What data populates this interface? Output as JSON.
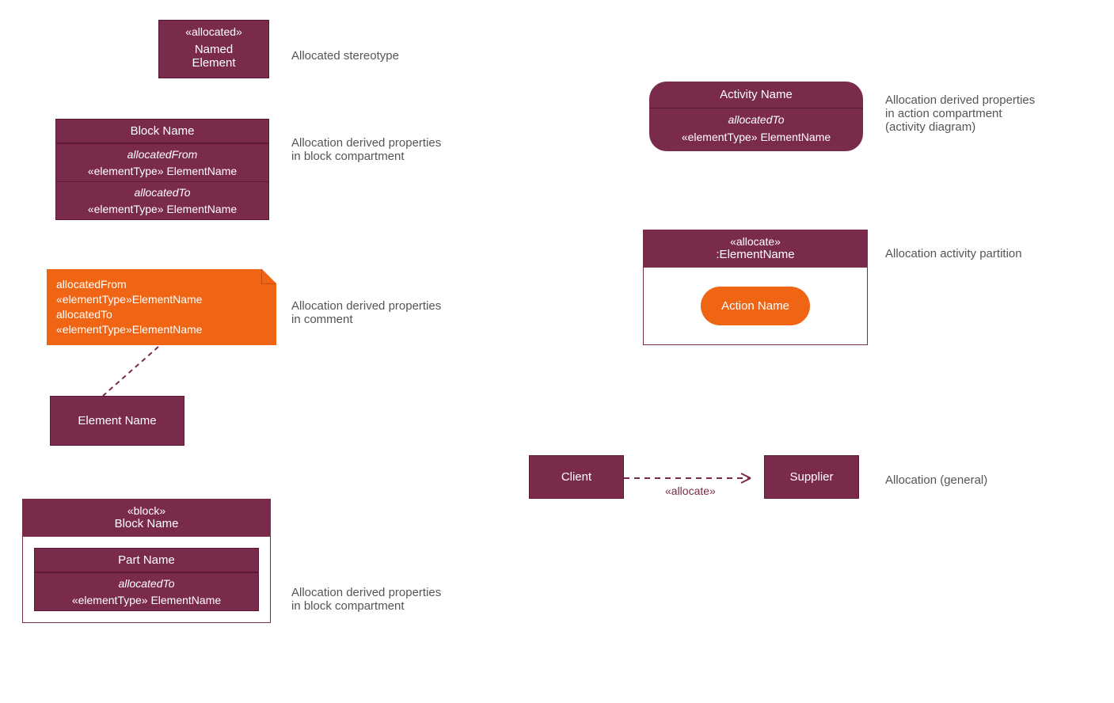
{
  "allocated_stereotype": {
    "stereotype": "«allocated»",
    "name_line1": "Named",
    "name_line2": "Element",
    "label": "Allocated stereotype"
  },
  "block_compartment": {
    "title": "Block Name",
    "from_label": "allocatedFrom",
    "from_value": "«elementType» ElementName",
    "to_label": "allocatedTo",
    "to_value": "«elementType» ElementName",
    "label_line1": "Allocation derived properties",
    "label_line2": "in block compartment"
  },
  "comment": {
    "line1": "allocatedFrom",
    "line2": "«elementType»ElementName",
    "line3": "allocatedTo",
    "line4": "«elementType»ElementName",
    "label_line1": "Allocation derived properties",
    "label_line2": "in comment",
    "element_name": "Element Name"
  },
  "activity": {
    "title": "Activity Name",
    "to_label": "allocatedTo",
    "to_value": "«elementType» ElementName",
    "label_line1": "Allocation derived properties",
    "label_line2": "in action compartment",
    "label_line3": "(activity diagram)"
  },
  "partition": {
    "stereotype": "«allocate»",
    "name": ":ElementName",
    "action": "Action Name",
    "label": "Allocation activity partition"
  },
  "general": {
    "client": "Client",
    "supplier": "Supplier",
    "stereotype": "«allocate»",
    "label": "Allocation (general)"
  },
  "block_part": {
    "stereotype": "«block»",
    "title": "Block Name",
    "part_title": "Part Name",
    "to_label": "allocatedTo",
    "to_value": "«elementType» ElementName",
    "label_line1": "Allocation derived properties",
    "label_line2": "in block compartment"
  }
}
